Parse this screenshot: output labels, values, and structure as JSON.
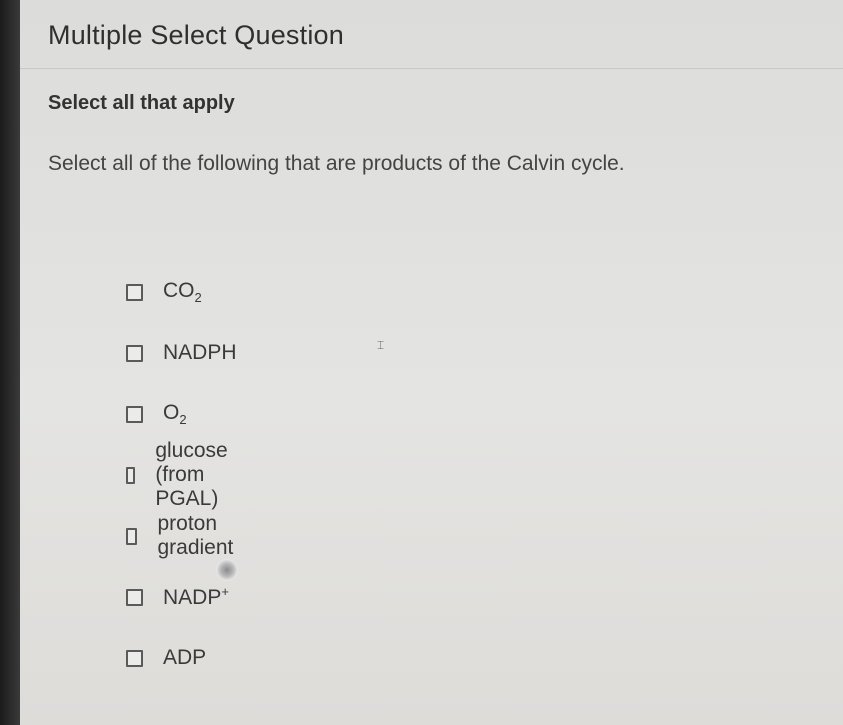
{
  "question": {
    "title": "Multiple Select Question",
    "instruction": "Select all that apply",
    "prompt": "Select all of the following that are products of the Calvin cycle."
  },
  "options": [
    {
      "base": "CO",
      "sub": "2",
      "sup": "",
      "checked": false
    },
    {
      "base": "NADPH",
      "sub": "",
      "sup": "",
      "checked": false
    },
    {
      "base": "O",
      "sub": "2",
      "sup": "",
      "checked": false
    },
    {
      "base": "glucose (from PGAL)",
      "sub": "",
      "sup": "",
      "checked": false
    },
    {
      "base": "proton gradient",
      "sub": "",
      "sup": "",
      "checked": false
    },
    {
      "base": "NADP",
      "sub": "",
      "sup": "+",
      "checked": false
    },
    {
      "base": "ADP",
      "sub": "",
      "sup": "",
      "checked": false
    }
  ],
  "icons": {
    "checkbox": "checkbox-icon",
    "cursor": "mouse-cursor-icon",
    "busy": "loading-spinner-icon"
  }
}
